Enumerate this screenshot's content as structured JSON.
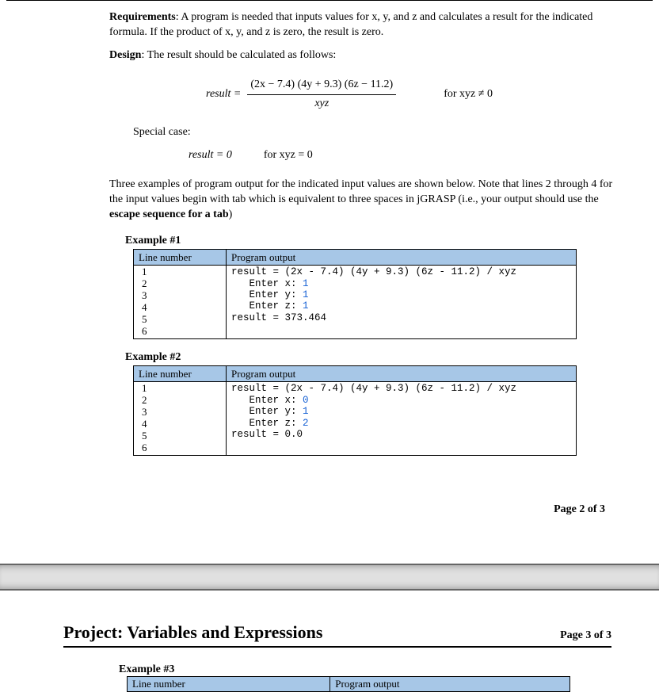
{
  "requirements_label": "Requirements",
  "requirements_text": ": A program is needed that inputs values for x, y, and z and calculates a result for the indicated formula.  If the product of x, y, and z is zero, the result is zero.",
  "design_label": "Design",
  "design_text": ": The result should be calculated as follows:",
  "formula": {
    "lhs": "result =",
    "numerator": "(2x − 7.4) (4y + 9.3) (6z − 11.2)",
    "denominator": "xyz",
    "condition": "for xyz ≠ 0"
  },
  "special_case_label": "Special case:",
  "special_case": {
    "lhs": "result = 0",
    "condition": "for xyz = 0"
  },
  "examples_intro_1": "Three examples of program output for the indicated input values are shown below.  Note that lines 2 through 4 for the input values begin with tab which is equivalent to three spaces in jGRASP (i.e., your output should use the ",
  "examples_intro_bold": "escape sequence for a tab",
  "examples_intro_2": ")",
  "col_line": "Line number",
  "col_output": "Program output",
  "ex1_title": "Example #1",
  "ex1": {
    "lines": "1\n2\n3\n4\n5\n6",
    "out_l1": "result = (2x - 7.4) (4y + 9.3) (6z - 11.2) / xyz",
    "out_l2a": "   Enter x: ",
    "out_l2b": "1",
    "out_l3a": "   Enter y: ",
    "out_l3b": "1",
    "out_l4a": "   Enter z: ",
    "out_l4b": "1",
    "out_l5": "result = 373.464",
    "out_l6": ""
  },
  "ex2_title": "Example #2",
  "ex2": {
    "lines": "1\n2\n3\n4\n5\n6",
    "out_l1": "result = (2x - 7.4) (4y + 9.3) (6z - 11.2) / xyz",
    "out_l2a": "   Enter x: ",
    "out_l2b": "0",
    "out_l3a": "   Enter y: ",
    "out_l3b": "1",
    "out_l4a": "   Enter z: ",
    "out_l4b": "2",
    "out_l5": "result = 0.0",
    "out_l6": ""
  },
  "page2_footer": "Page 2 of 3",
  "project_title": "Project: Variables and Expressions",
  "page3_label": "Page 3 of 3",
  "ex3_title": "Example #3"
}
